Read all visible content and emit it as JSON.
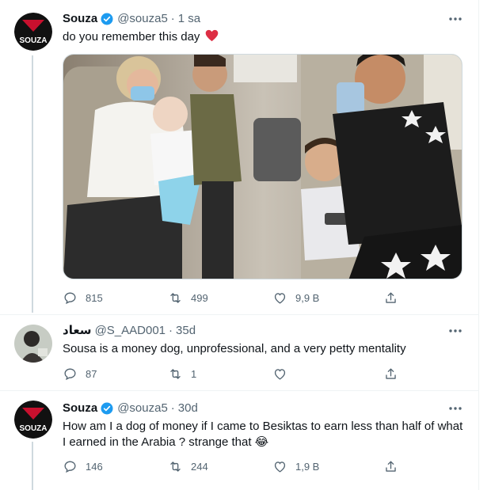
{
  "tweets": [
    {
      "name": "Souza",
      "handle": "@souza5",
      "time": "1 sa",
      "text": "do you remember this day",
      "emoji": "❤️",
      "replies": "815",
      "retweets": "499",
      "likes": "9,9 B"
    },
    {
      "name": "سعاد",
      "handle": "@S_AAD001",
      "time": "35d",
      "text": "Sousa is a money dog, unprofessional, and a very petty mentality",
      "replies": "87",
      "retweets": "1",
      "likes": ""
    },
    {
      "name": "Souza",
      "handle": "@souza5",
      "time": "30d",
      "text": "How am I a dog of money if I came to Besiktas to earn less than half of what I earned in the Arabia ? strange that 😂",
      "replies": "146",
      "retweets": "244",
      "likes": "1,9 B"
    }
  ],
  "avatar_text": "SOUZA",
  "colors": {
    "verified": "#1d9bf0",
    "secondary_text": "#536471",
    "thread_line": "#cfd9de"
  }
}
